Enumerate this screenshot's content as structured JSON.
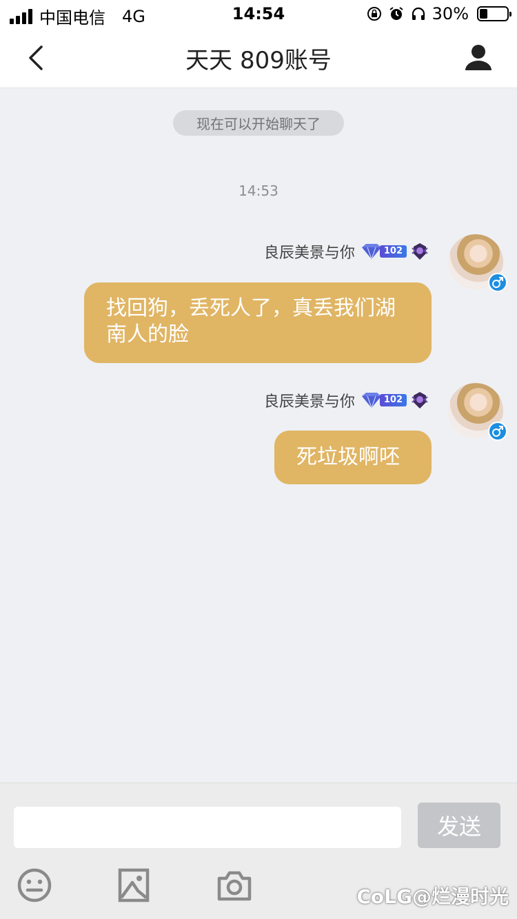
{
  "status_bar": {
    "carrier": "中国电信",
    "network": "4G",
    "time": "14:54",
    "battery_text": "30%",
    "battery_level": 0.3
  },
  "navbar": {
    "title": "天天 809账号"
  },
  "chat": {
    "system_message": "现在可以开始聊天了",
    "timestamp": "14:53",
    "messages": [
      {
        "sender": "良辰美景与你",
        "level": "102",
        "text": "找回狗，丢死人了，真丢我们湖南人的脸"
      },
      {
        "sender": "良辰美景与你",
        "level": "102",
        "text": "死垃圾啊呸"
      }
    ]
  },
  "input_bar": {
    "placeholder": "",
    "send_label": "发送"
  },
  "watermark": "CoLG@烂漫时光",
  "colors": {
    "bubble": "#e0b564",
    "background": "#eef0f3",
    "gender_badge": "#1d8ee0"
  }
}
